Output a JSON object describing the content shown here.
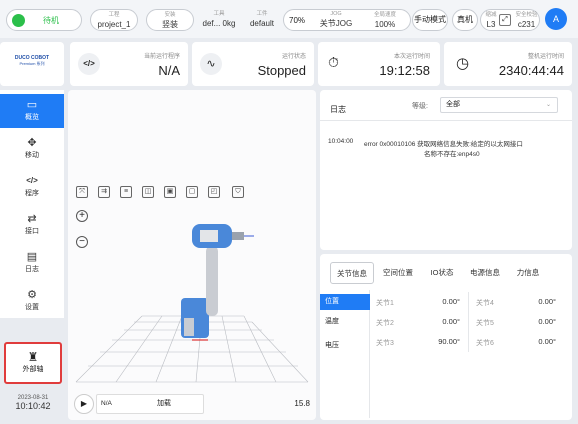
{
  "topbar": {
    "status_label": "待机",
    "project": {
      "label": "工程",
      "value": "project_1"
    },
    "install": {
      "label": "安装",
      "value": "竖装"
    },
    "tool": {
      "label": "工具",
      "value": "def... 0kg"
    },
    "workpiece": {
      "label": "工件",
      "value": "default"
    },
    "jog_percent": "70%",
    "jog": {
      "label": "JOG",
      "value": "关节JOG"
    },
    "global_speed": {
      "label": "全局速度",
      "value": "100%"
    },
    "manual_mode": "手动模式",
    "real_machine": "真机",
    "safety_mode": {
      "label": "缩减",
      "value": "L3"
    },
    "checksum": {
      "label": "安全校验",
      "value": "c231"
    },
    "avatar": "A"
  },
  "logo": {
    "brand": "DUCO COBOT",
    "sub": "Premium 系列"
  },
  "program_card": {
    "label": "当前运行程序",
    "value": "N/A"
  },
  "status_card": {
    "label": "运行状态",
    "value": "Stopped"
  },
  "runtime_card": {
    "label": "本次运行时间",
    "value": "19:12:58"
  },
  "total_card": {
    "label": "整机运行时间",
    "value": "2340:44:44"
  },
  "sidebar": {
    "items": [
      {
        "label": "概览"
      },
      {
        "label": "移动"
      },
      {
        "label": "程序"
      },
      {
        "label": "接口"
      },
      {
        "label": "日志"
      },
      {
        "label": "设置"
      }
    ],
    "external_axis": "外部轴"
  },
  "datetime": {
    "date": "2023-08-31",
    "time": "10:10:42"
  },
  "player": {
    "program": "N/A",
    "load_label": "加载",
    "speed": "15.8"
  },
  "log": {
    "title": "日志",
    "level_label": "等级:",
    "level_value": "全部",
    "entries": [
      {
        "time": "10:04:00",
        "text": "error 0x00010106 获取网络信息失败:给定的以太网接口",
        "text2": "名称不存在:enp4s0"
      }
    ]
  },
  "tabs": [
    "关节信息",
    "空间位置",
    "IO状态",
    "电源信息",
    "力信息"
  ],
  "subnav": [
    "位置",
    "温度",
    "电压"
  ],
  "joints": [
    {
      "name": "关节1",
      "value": "0.00°"
    },
    {
      "name": "关节2",
      "value": "0.00°"
    },
    {
      "name": "关节3",
      "value": "90.00°"
    },
    {
      "name": "关节4",
      "value": "0.00°"
    },
    {
      "name": "关节5",
      "value": "0.00°"
    },
    {
      "name": "关节6",
      "value": "0.00°"
    }
  ],
  "colors": {
    "accent": "#1f7cf5",
    "status_green": "#2bbf4a",
    "alert": "#e03c3c"
  }
}
